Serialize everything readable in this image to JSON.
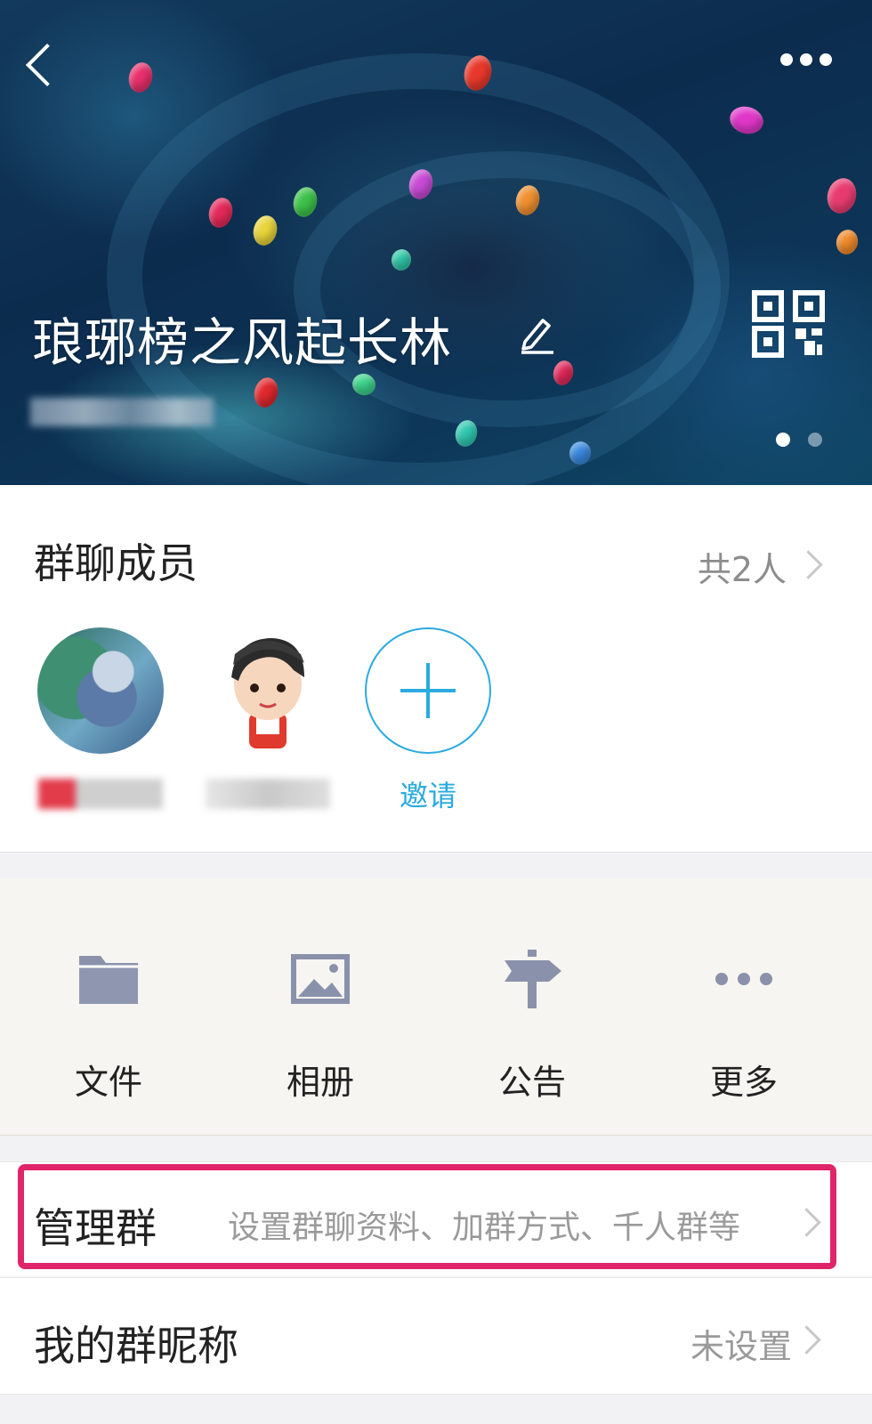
{
  "header": {
    "group_name": "琅琊榜之风起长林",
    "back_icon": "chevron-left-icon",
    "more_icon": "more-dots-icon",
    "edit_icon": "pencil-icon",
    "qr_icon": "qr-code-icon"
  },
  "members": {
    "title": "群聊成员",
    "count": "共2人",
    "invite_label": "邀请"
  },
  "tools": [
    {
      "label": "文件",
      "icon": "folder-icon"
    },
    {
      "label": "相册",
      "icon": "image-icon"
    },
    {
      "label": "公告",
      "icon": "signpost-icon"
    },
    {
      "label": "更多",
      "icon": "more-dots-icon"
    }
  ],
  "manage": {
    "title": "管理群",
    "desc": "设置群聊资料、加群方式、千人群等"
  },
  "nickname": {
    "title": "我的群昵称",
    "value": "未设置"
  },
  "colors": {
    "accent": "#2aaae0",
    "highlight": "#e0246a"
  }
}
